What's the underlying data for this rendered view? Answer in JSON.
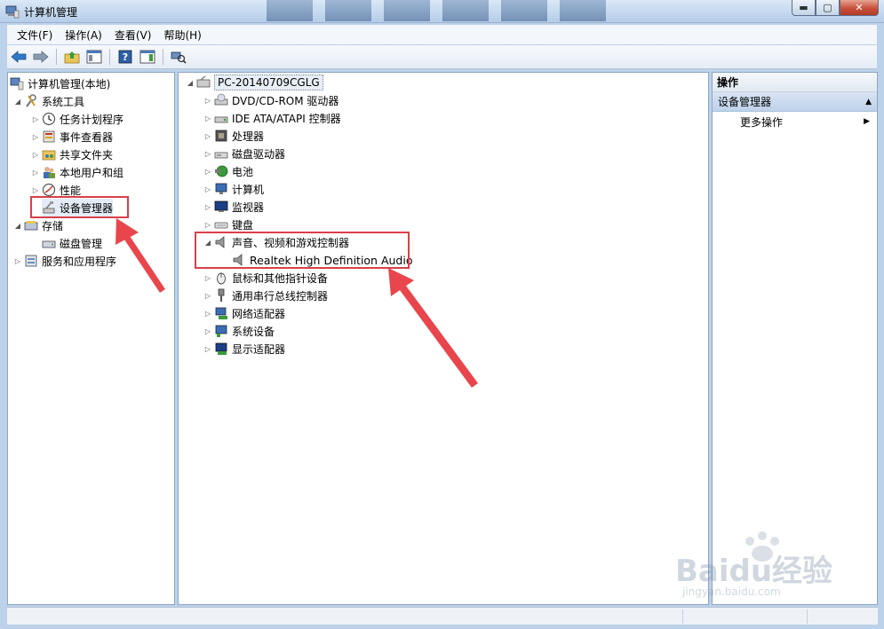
{
  "window": {
    "title": "计算机管理"
  },
  "menu": [
    "文件(F)",
    "操作(A)",
    "查看(V)",
    "帮助(H)"
  ],
  "left_tree": {
    "root": "计算机管理(本地)",
    "system_tools": "系统工具",
    "items": [
      "任务计划程序",
      "事件查看器",
      "共享文件夹",
      "本地用户和组",
      "性能",
      "设备管理器"
    ],
    "storage": "存储",
    "disk_management": "磁盘管理",
    "services": "服务和应用程序"
  },
  "device_tree": {
    "computer": "PC-20140709CGLG",
    "categories": [
      "DVD/CD-ROM 驱动器",
      "IDE ATA/ATAPI 控制器",
      "处理器",
      "磁盘驱动器",
      "电池",
      "计算机",
      "监视器",
      "键盘",
      "声音、视频和游戏控制器",
      "鼠标和其他指针设备",
      "通用串行总线控制器",
      "网络适配器",
      "系统设备",
      "显示适配器"
    ],
    "sound_child": "Realtek High Definition Audio"
  },
  "actions": {
    "header": "操作",
    "section": "设备管理器",
    "more": "更多操作"
  },
  "watermark": {
    "brand": "Baidu经验",
    "url": "jingyan.baidu.com"
  },
  "colors": {
    "highlight": "#d9404a",
    "arrow": "#e8464c",
    "selection": "#c9dcf2"
  }
}
